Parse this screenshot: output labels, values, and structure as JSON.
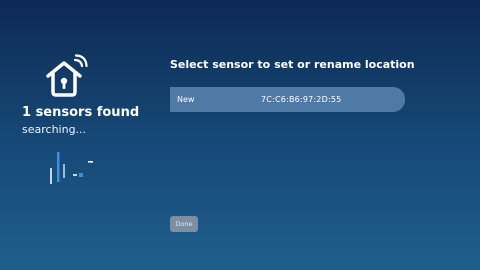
{
  "status": {
    "found_text": "1 sensors found",
    "searching_text": "searching..."
  },
  "icons": {
    "home": "home-wifi-icon",
    "signal": "signal-bars-icon"
  },
  "main": {
    "heading": "Select sensor to set or rename location",
    "sensors": [
      {
        "location": "New",
        "mac": "7C:C6:B6:97:2D:55"
      }
    ],
    "done_label": "Done"
  },
  "colors": {
    "background_top": "#0d2a55",
    "background_bottom": "#1f5f8c",
    "row_highlight": "#4f7aa6",
    "bar_accent": "#3f8fd9",
    "button": "#7d90a3"
  }
}
